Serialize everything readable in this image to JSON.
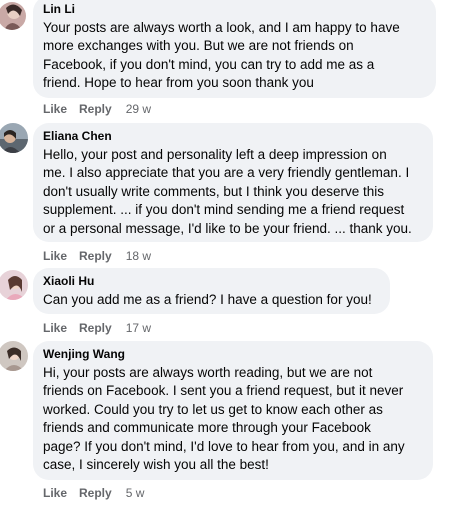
{
  "comments": [
    {
      "author": "Lin Li",
      "text": "Your posts are always worth a look, and I am happy to have\nmore exchanges with you. But we are not friends on\nFacebook, if you don't mind, you can try to add me as a\nfriend. Hope to hear from you soon thank you",
      "like": "Like",
      "reply": "Reply",
      "time": "29 w"
    },
    {
      "author": "Eliana Chen",
      "text": "Hello, your post and personality left a deep impression on\nme. I also appreciate that you are a very friendly gentleman. I\ndon't usually write comments, but I think you deserve this\nsupplement. ... if you don't mind sending me a friend request\nor a personal message, I'd like to be your friend. ... thank you.",
      "like": "Like",
      "reply": "Reply",
      "time": "18 w"
    },
    {
      "author": "Xiaoli Hu",
      "text": "Can you add me as a friend? I have a question for you!",
      "like": "Like",
      "reply": "Reply",
      "time": "17 w"
    },
    {
      "author": "Wenjing Wang",
      "text": "Hi, your posts are always worth reading, but we are not\nfriends on Facebook. I sent you a friend request, but it never\nworked. Could you try to let us get to know each other as\nfriends and communicate more through your Facebook\npage? If you don't mind, I'd love to hear from you, and in any\ncase, I sincerely wish you all the best!",
      "like": "Like",
      "reply": "Reply",
      "time": "5 w"
    }
  ],
  "colors": {
    "bubble": "#f0f2f5",
    "text": "#050505",
    "secondary": "#65676b"
  }
}
